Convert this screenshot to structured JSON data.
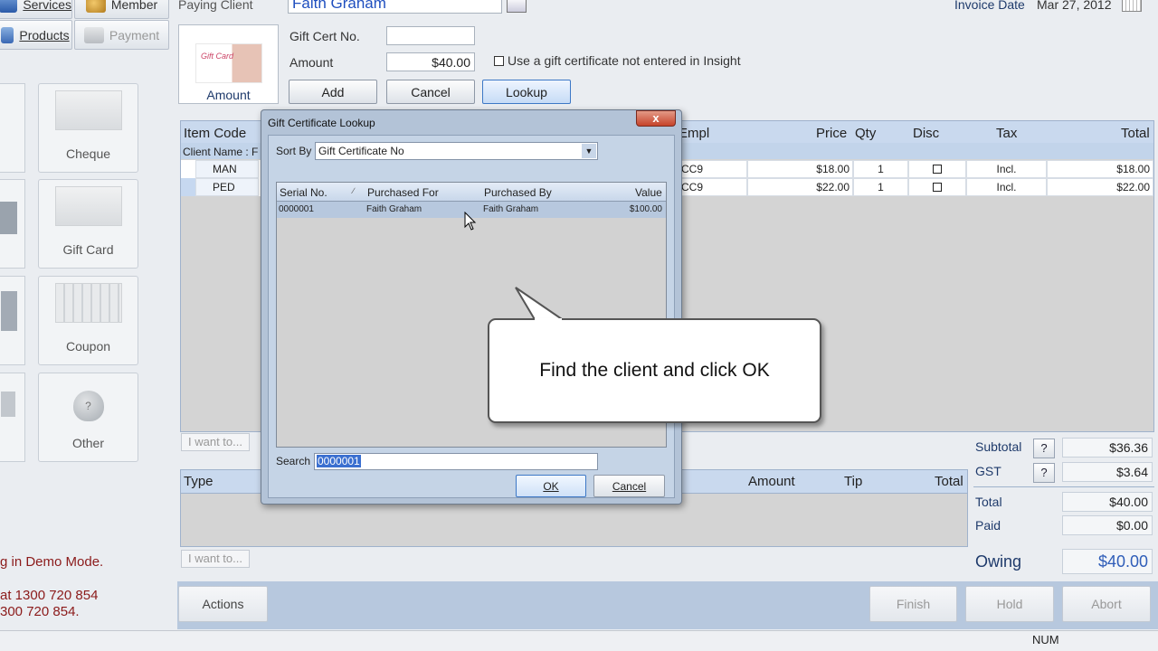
{
  "nav": {
    "services_label": "Services",
    "member_label": "Member",
    "products_label": "Products",
    "payment_label": "Payment"
  },
  "payment_methods": [
    {
      "label": "Cheque"
    },
    {
      "label": "Gift Card"
    },
    {
      "label": "Coupon"
    },
    {
      "label": "Other"
    }
  ],
  "left_partial": {
    "demo_text": "g in Demo Mode.",
    "phone_line1": "at 1300 720 854",
    "phone_line2": "300 720 854."
  },
  "client": {
    "paying_client_label": "Paying Client",
    "paying_client_value": "Faith Graham",
    "invoice_date_label": "Invoice Date",
    "invoice_date_value": "Mar 27, 2012"
  },
  "giftcert": {
    "card_caption": "Gift Card",
    "amount_caption": "Amount",
    "cert_no_label": "Gift Cert No.",
    "cert_no_value": "",
    "amount_label": "Amount",
    "amount_value": "$40.00",
    "checkbox_label": "Use a gift certificate not entered in Insight",
    "add_label": "Add",
    "cancel_label": "Cancel",
    "lookup_label": "Lookup"
  },
  "items_table": {
    "headers": {
      "item_code": "Item Code",
      "empl": "Empl",
      "price": "Price",
      "qty": "Qty",
      "disc": "Disc",
      "tax": "Tax",
      "total": "Total"
    },
    "client_name_label": "Client Name : F",
    "rows": [
      {
        "code": "MAN",
        "empl": "CC9",
        "price": "$18.00",
        "qty": "1",
        "tax": "Incl.",
        "total": "$18.00"
      },
      {
        "code": "PED",
        "empl": "CC9",
        "price": "$22.00",
        "qty": "1",
        "tax": "Incl.",
        "total": "$22.00"
      }
    ],
    "i_want_to": "I want to..."
  },
  "payments_table": {
    "headers": {
      "type": "Type",
      "amount": "Amount",
      "tip": "Tip",
      "total": "Total"
    },
    "i_want_to": "I want to..."
  },
  "summary": {
    "subtotal_label": "Subtotal",
    "subtotal_value": "$36.36",
    "gst_label": "GST",
    "gst_value": "$3.64",
    "total_label": "Total",
    "total_value": "$40.00",
    "paid_label": "Paid",
    "paid_value": "$0.00",
    "owing_label": "Owing",
    "owing_value": "$40.00",
    "help_glyph": "?"
  },
  "bottom": {
    "actions_label": "Actions",
    "finish_label": "Finish",
    "hold_label": "Hold",
    "abort_label": "Abort",
    "status_num": "NUM"
  },
  "dialog": {
    "title": "Gift Certificate Lookup",
    "close_glyph": "x",
    "sort_by_label": "Sort By",
    "sort_by_value": "Gift Certificate No",
    "columns": {
      "serial": "Serial No.",
      "for": "Purchased For",
      "by": "Purchased By",
      "value": "Value"
    },
    "rows": [
      {
        "serial": "0000001",
        "for": "Faith Graham",
        "by": "Faith Graham",
        "value": "$100.00"
      }
    ],
    "search_label": "Search",
    "search_value": "0000001",
    "ok_label": "OK",
    "cancel_label": "Cancel"
  },
  "callout": {
    "text": "Find the client and click OK"
  },
  "colors": {
    "accent": "#c9d9ee",
    "owing": "#2f5db8",
    "demo_text": "#8b1a1a"
  }
}
